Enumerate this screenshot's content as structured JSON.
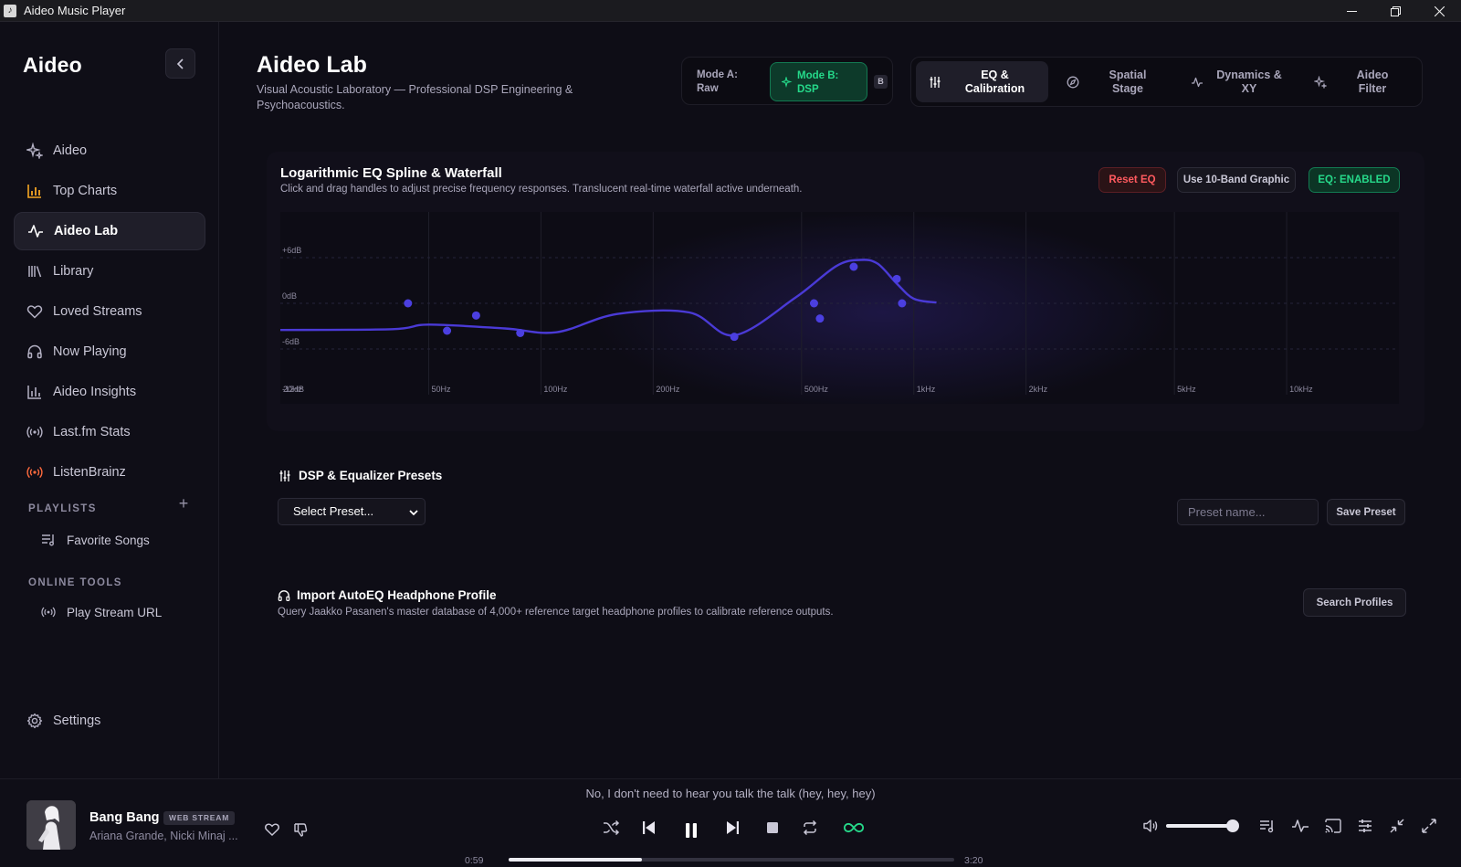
{
  "window": {
    "title": "Aideo Music Player"
  },
  "sidebar": {
    "brand": "Aideo",
    "items": [
      {
        "label": "Aideo",
        "icon": "sparkle-icon"
      },
      {
        "label": "Top Charts",
        "icon": "bar-chart-icon",
        "accent": "#f5a623"
      },
      {
        "label": "Aideo Lab",
        "icon": "pulse-icon",
        "active": true
      },
      {
        "label": "Library",
        "icon": "library-icon"
      },
      {
        "label": "Loved Streams",
        "icon": "heart-icon"
      },
      {
        "label": "Now Playing",
        "icon": "headphones-icon"
      },
      {
        "label": "Aideo Insights",
        "icon": "bar-chart-icon"
      },
      {
        "label": "Last.fm Stats",
        "icon": "broadcast-icon"
      },
      {
        "label": "ListenBrainz",
        "icon": "broadcast-icon",
        "accent": "#ff6a3d"
      }
    ],
    "playlists_label": "PLAYLISTS",
    "playlists": [
      {
        "label": "Favorite Songs",
        "icon": "playlist-icon"
      }
    ],
    "online_tools_label": "ONLINE TOOLS",
    "online_tools": [
      {
        "label": "Play Stream URL",
        "icon": "broadcast-icon"
      }
    ],
    "settings_label": "Settings"
  },
  "header": {
    "title": "Aideo Lab",
    "subtitle": "Visual Acoustic Laboratory — Professional DSP Engineering & Psychoacoustics.",
    "mode_a": "Mode A:\nRaw",
    "mode_b": "Mode B:\nDSP",
    "ab_badge": "B",
    "tabs": [
      {
        "label": "EQ &\nCalibration",
        "icon": "sliders-icon",
        "active": true
      },
      {
        "label": "Spatial\nStage",
        "icon": "compass-icon"
      },
      {
        "label": "Dynamics &\nXY",
        "icon": "pulse-icon"
      },
      {
        "label": "Aideo\nFilter",
        "icon": "sparkle-icon"
      }
    ]
  },
  "eq": {
    "title": "Logarithmic EQ Spline & Waterfall",
    "subtitle": "Click and drag handles to adjust precise frequency responses. Translucent real-time waterfall active underneath.",
    "reset_label": "Reset EQ",
    "graphic_label": "Use 10-Band Graphic",
    "enabled_label": "EQ: ENABLED",
    "colors": {
      "curve": "#4a3ad6",
      "handle": "#4b3fe0",
      "enabled": "#26d98a",
      "reset": "#ff5a5f"
    }
  },
  "chart_data": {
    "type": "line",
    "x_scale": "log",
    "x_ticks": [
      "20Hz",
      "50Hz",
      "100Hz",
      "200Hz",
      "500Hz",
      "1kHz",
      "2kHz",
      "5kHz",
      "10kHz"
    ],
    "x_tick_values": [
      20,
      50,
      100,
      200,
      500,
      1000,
      2000,
      5000,
      10000
    ],
    "y_ticks": [
      "+6dB",
      "0dB",
      "-6dB"
    ],
    "y_tick_values": [
      6,
      0,
      -6
    ],
    "ylim": [
      -12,
      12
    ],
    "x_range": [
      20,
      20000
    ],
    "extra_label": "-12dB",
    "grid": true,
    "series": [
      {
        "x": [
          20,
          40,
          50,
          80,
          110,
          160,
          250,
          330,
          480,
          620,
          720,
          800,
          900,
          1000,
          1150
        ],
        "y": [
          -3.5,
          -3.4,
          -2.8,
          -3.3,
          -3.8,
          -1.4,
          -1.2,
          -4.2,
          0.7,
          4.9,
          5.7,
          5.2,
          2.6,
          0.6,
          0.1
        ]
      }
    ],
    "handles": [
      {
        "x": 44,
        "y": 0.0
      },
      {
        "x": 56,
        "y": -3.6
      },
      {
        "x": 67,
        "y": -1.6
      },
      {
        "x": 88,
        "y": -3.9
      },
      {
        "x": 330,
        "y": -4.4
      },
      {
        "x": 540,
        "y": 0.0
      },
      {
        "x": 560,
        "y": -2.0
      },
      {
        "x": 690,
        "y": 4.8
      },
      {
        "x": 900,
        "y": 3.2
      },
      {
        "x": 930,
        "y": 0.0
      }
    ]
  },
  "presets": {
    "title": "DSP & Equalizer Presets",
    "select_value": "Select Preset...",
    "name_placeholder": "Preset name...",
    "save_label": "Save Preset"
  },
  "autoeq": {
    "title": "Import AutoEQ Headphone Profile",
    "subtitle": "Query Jaakko Pasanen's master database of 4,000+ reference target headphone profiles to calibrate reference outputs.",
    "search_label": "Search Profiles"
  },
  "player": {
    "lyric": "No, I don't need to hear you talk the talk (hey, hey, hey)",
    "track_title": "Bang Bang",
    "badge": "WEB STREAM",
    "artist": "Ariana Grande, Nicki Minaj ...",
    "elapsed": "0:59",
    "duration": "3:20",
    "progress": 0.3,
    "volume": 0.97,
    "accent": "#26d98a"
  }
}
